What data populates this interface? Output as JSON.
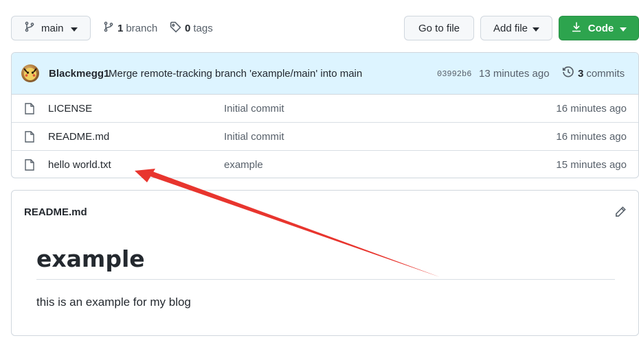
{
  "toolbar": {
    "branch_label": "main",
    "branches_count": "1",
    "branches_label": "branch",
    "tags_count": "0",
    "tags_label": "tags",
    "go_to_file_label": "Go to file",
    "add_file_label": "Add file",
    "code_label": "Code"
  },
  "latest_commit": {
    "author": "Blackmegg1",
    "message": "Merge remote-tracking branch 'example/main' into main",
    "sha": "03992b6",
    "time": "13 minutes ago",
    "commits_count": "3",
    "commits_label": "commits"
  },
  "files": [
    {
      "name": "LICENSE",
      "message": "Initial commit",
      "time": "16 minutes ago"
    },
    {
      "name": "README.md",
      "message": "Initial commit",
      "time": "16 minutes ago"
    },
    {
      "name": "hello world.txt",
      "message": "example",
      "time": "15 minutes ago"
    }
  ],
  "readme": {
    "title": "README.md",
    "heading": "example",
    "paragraph": "this is an example for my blog"
  },
  "colors": {
    "code_button": "#2da44e",
    "commit_bar": "#ddf4ff",
    "annotation_arrow": "#e8352e"
  },
  "icons": {
    "branch": "git-branch-icon",
    "tag": "tag-icon",
    "download": "download-icon",
    "history": "history-icon",
    "file": "file-icon",
    "edit": "pencil-icon"
  }
}
